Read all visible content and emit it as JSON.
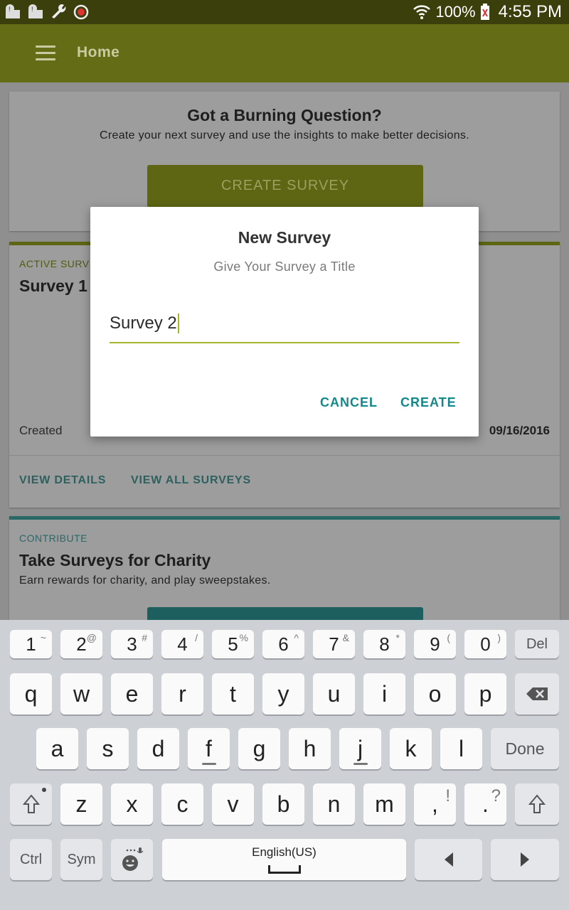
{
  "status_bar": {
    "left_icons": [
      "alert-pin-icon",
      "alert-pin-icon",
      "wrench-icon",
      "do-not-disturb-icon"
    ],
    "battery": "100%",
    "time": "4:55 PM"
  },
  "app_bar": {
    "title": "Home"
  },
  "cards": {
    "burning": {
      "title": "Got a Burning Question?",
      "subtitle": "Create your next survey and use the insights to make better decisions.",
      "button": "CREATE SURVEY"
    },
    "active": {
      "kicker": "ACTIVE SURV",
      "title": "Survey 1",
      "created_label": "Created",
      "created_date": "09/16/2016",
      "links": [
        "VIEW DETAILS",
        "VIEW ALL SURVEYS"
      ]
    },
    "contribute": {
      "kicker": "CONTRIBUTE",
      "title": "Take Surveys for Charity",
      "subtitle": "Earn rewards for charity, and play sweepstakes."
    }
  },
  "dialog": {
    "title": "New Survey",
    "subtitle": "Give Your Survey a Title",
    "input_value": "Survey 2",
    "cancel": "CANCEL",
    "create": "CREATE"
  },
  "keyboard": {
    "number_row": [
      {
        "k": "1",
        "s": "~"
      },
      {
        "k": "2",
        "s": "@"
      },
      {
        "k": "3",
        "s": "#"
      },
      {
        "k": "4",
        "s": "/"
      },
      {
        "k": "5",
        "s": "%"
      },
      {
        "k": "6",
        "s": "^"
      },
      {
        "k": "7",
        "s": "&"
      },
      {
        "k": "8",
        "s": "*"
      },
      {
        "k": "9",
        "s": "("
      },
      {
        "k": "0",
        "s": ")"
      }
    ],
    "del": "Del",
    "row1": [
      "q",
      "w",
      "e",
      "r",
      "t",
      "y",
      "u",
      "i",
      "o",
      "p"
    ],
    "row2": [
      "a",
      "s",
      "d",
      "f",
      "g",
      "h",
      "j",
      "k",
      "l"
    ],
    "row3": [
      "z",
      "x",
      "c",
      "v",
      "b",
      "n",
      "m"
    ],
    "comma": ",",
    "comma_alt": "!",
    "period": ".",
    "period_alt": "?",
    "done": "Done",
    "ctrl": "Ctrl",
    "sym": "Sym",
    "space_label": "English(US)",
    "colors": {
      "key": "#fafafa",
      "func_key": "#e4e6e9",
      "background": "#cdd0d5"
    }
  }
}
